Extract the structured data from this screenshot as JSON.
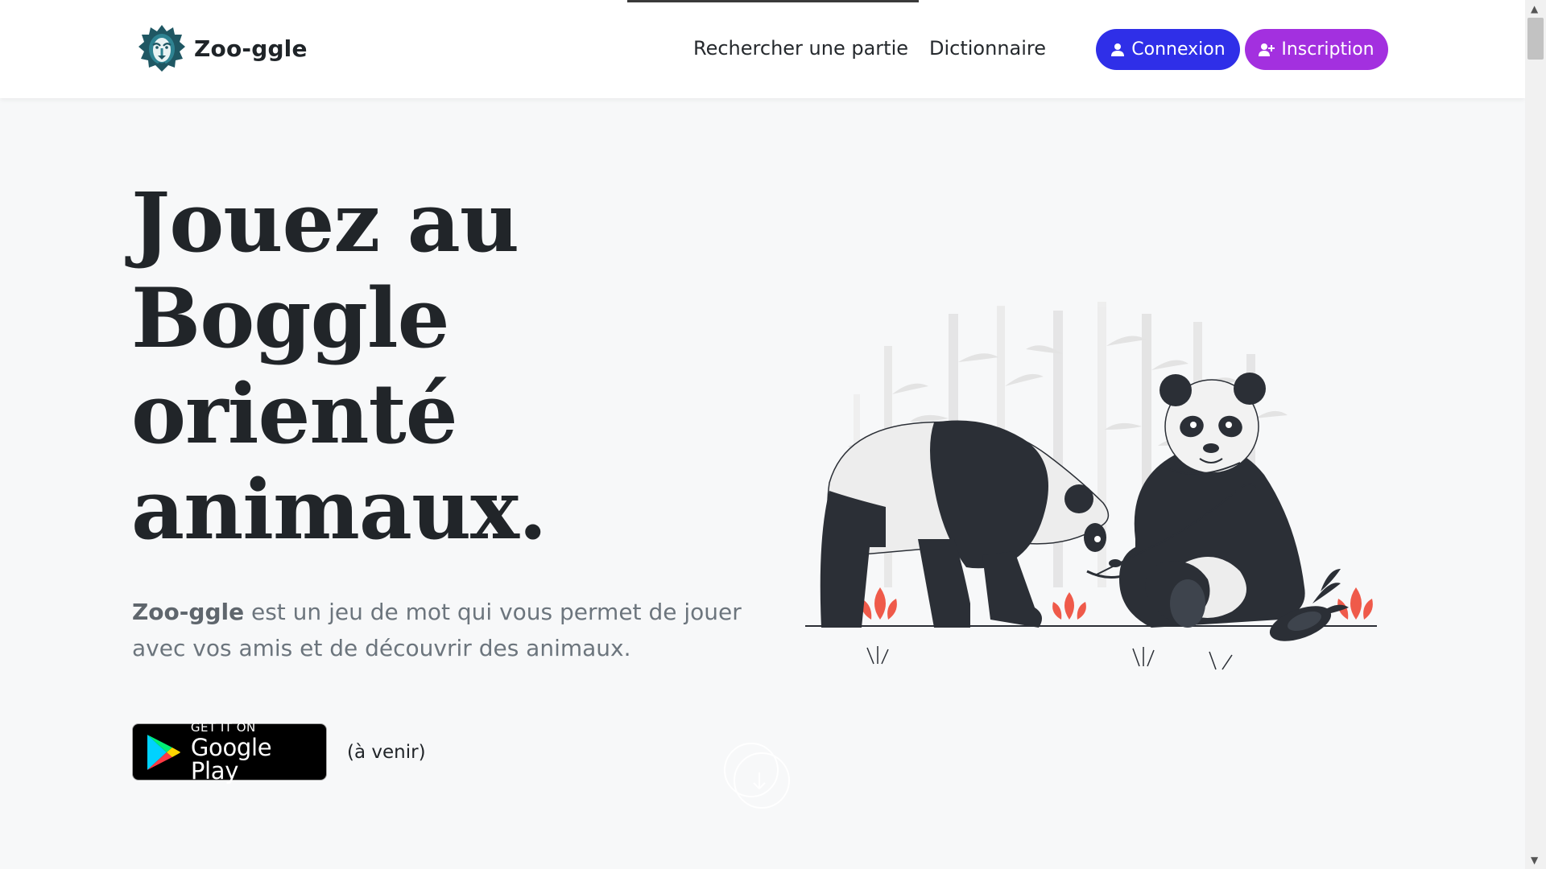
{
  "brand": {
    "name": "Zoo-ggle",
    "logo_icon": "lion-icon"
  },
  "nav": {
    "search_label": "Rechercher une partie",
    "dictionary_label": "Dictionnaire"
  },
  "auth": {
    "login_label": "Connexion",
    "login_icon": "user-icon",
    "signup_label": "Inscription",
    "signup_icon": "user-plus-icon"
  },
  "hero": {
    "title": "Jouez au Boggle orienté animaux.",
    "desc_brand": "Zoo-ggle",
    "desc_rest": " est un jeu de mot qui vous permet de jouer avec vos amis et de découvrir des animaux."
  },
  "store": {
    "badge_small": "GET IT ON",
    "badge_big": "Google Play",
    "note": "(à venir)"
  },
  "colors": {
    "login_bg": "#2f2fe8",
    "signup_bg": "#a330df",
    "page_bg": "#f7f8f9",
    "accent_red": "#ef5a4a"
  }
}
